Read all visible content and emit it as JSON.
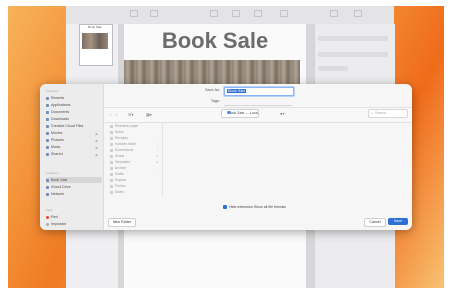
{
  "colors": {
    "accent": "#2f6fd6",
    "wallpaper_orange": "#f07b22"
  },
  "slide": {
    "thumb_title": "Book Sale",
    "title": "Book Sale"
  },
  "dialog": {
    "save_as_label": "Save As:",
    "save_as_value": "Book Sale",
    "tags_label": "Tags:",
    "tags_placeholder": "",
    "location": "Book Sale — Local",
    "search_placeholder": "Search",
    "hide_extension_label": "Hide extension  Show all file formats",
    "new_folder_label": "New Folder",
    "cancel_label": "Cancel",
    "save_label": "Save"
  },
  "sidebar": {
    "favorites_header": "Favorites",
    "locations_header": "Locations",
    "tags_header": "Tags",
    "favorites": [
      "Recents",
      "Applications",
      "Documents",
      "Downloads",
      "Creative Cloud Files",
      "Movies",
      "Pictures",
      "Music",
      "Shared"
    ],
    "locations": [
      "iCloud Drive",
      "Network"
    ],
    "tags": [
      "Red",
      "Important"
    ]
  },
  "files": [
    "Research paper",
    "Notes",
    "Receipts",
    "Invoices folder",
    "Screenshots",
    "Scans",
    "Templates",
    "Archive",
    "Drafts",
    "Exports",
    "Photos",
    "Slides"
  ]
}
